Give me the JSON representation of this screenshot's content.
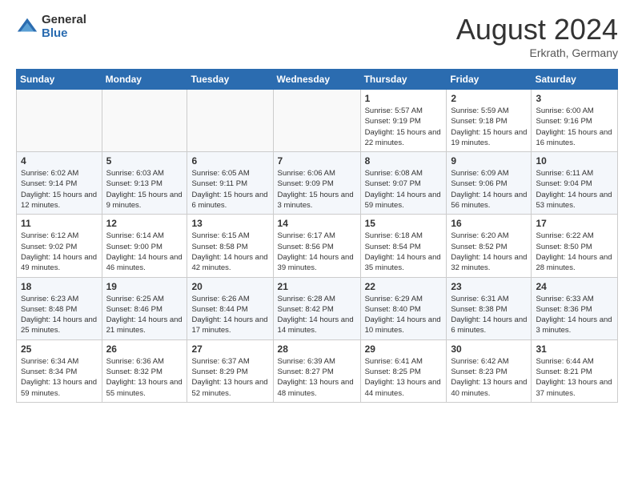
{
  "header": {
    "logo_general": "General",
    "logo_blue": "Blue",
    "month_title": "August 2024",
    "location": "Erkrath, Germany"
  },
  "days_of_week": [
    "Sunday",
    "Monday",
    "Tuesday",
    "Wednesday",
    "Thursday",
    "Friday",
    "Saturday"
  ],
  "weeks": [
    [
      {
        "day": "",
        "sunrise": "",
        "sunset": "",
        "daylight": ""
      },
      {
        "day": "",
        "sunrise": "",
        "sunset": "",
        "daylight": ""
      },
      {
        "day": "",
        "sunrise": "",
        "sunset": "",
        "daylight": ""
      },
      {
        "day": "",
        "sunrise": "",
        "sunset": "",
        "daylight": ""
      },
      {
        "day": "1",
        "sunrise": "5:57 AM",
        "sunset": "9:19 PM",
        "daylight": "15 hours and 22 minutes."
      },
      {
        "day": "2",
        "sunrise": "5:59 AM",
        "sunset": "9:18 PM",
        "daylight": "15 hours and 19 minutes."
      },
      {
        "day": "3",
        "sunrise": "6:00 AM",
        "sunset": "9:16 PM",
        "daylight": "15 hours and 16 minutes."
      }
    ],
    [
      {
        "day": "4",
        "sunrise": "6:02 AM",
        "sunset": "9:14 PM",
        "daylight": "15 hours and 12 minutes."
      },
      {
        "day": "5",
        "sunrise": "6:03 AM",
        "sunset": "9:13 PM",
        "daylight": "15 hours and 9 minutes."
      },
      {
        "day": "6",
        "sunrise": "6:05 AM",
        "sunset": "9:11 PM",
        "daylight": "15 hours and 6 minutes."
      },
      {
        "day": "7",
        "sunrise": "6:06 AM",
        "sunset": "9:09 PM",
        "daylight": "15 hours and 3 minutes."
      },
      {
        "day": "8",
        "sunrise": "6:08 AM",
        "sunset": "9:07 PM",
        "daylight": "14 hours and 59 minutes."
      },
      {
        "day": "9",
        "sunrise": "6:09 AM",
        "sunset": "9:06 PM",
        "daylight": "14 hours and 56 minutes."
      },
      {
        "day": "10",
        "sunrise": "6:11 AM",
        "sunset": "9:04 PM",
        "daylight": "14 hours and 53 minutes."
      }
    ],
    [
      {
        "day": "11",
        "sunrise": "6:12 AM",
        "sunset": "9:02 PM",
        "daylight": "14 hours and 49 minutes."
      },
      {
        "day": "12",
        "sunrise": "6:14 AM",
        "sunset": "9:00 PM",
        "daylight": "14 hours and 46 minutes."
      },
      {
        "day": "13",
        "sunrise": "6:15 AM",
        "sunset": "8:58 PM",
        "daylight": "14 hours and 42 minutes."
      },
      {
        "day": "14",
        "sunrise": "6:17 AM",
        "sunset": "8:56 PM",
        "daylight": "14 hours and 39 minutes."
      },
      {
        "day": "15",
        "sunrise": "6:18 AM",
        "sunset": "8:54 PM",
        "daylight": "14 hours and 35 minutes."
      },
      {
        "day": "16",
        "sunrise": "6:20 AM",
        "sunset": "8:52 PM",
        "daylight": "14 hours and 32 minutes."
      },
      {
        "day": "17",
        "sunrise": "6:22 AM",
        "sunset": "8:50 PM",
        "daylight": "14 hours and 28 minutes."
      }
    ],
    [
      {
        "day": "18",
        "sunrise": "6:23 AM",
        "sunset": "8:48 PM",
        "daylight": "14 hours and 25 minutes."
      },
      {
        "day": "19",
        "sunrise": "6:25 AM",
        "sunset": "8:46 PM",
        "daylight": "14 hours and 21 minutes."
      },
      {
        "day": "20",
        "sunrise": "6:26 AM",
        "sunset": "8:44 PM",
        "daylight": "14 hours and 17 minutes."
      },
      {
        "day": "21",
        "sunrise": "6:28 AM",
        "sunset": "8:42 PM",
        "daylight": "14 hours and 14 minutes."
      },
      {
        "day": "22",
        "sunrise": "6:29 AM",
        "sunset": "8:40 PM",
        "daylight": "14 hours and 10 minutes."
      },
      {
        "day": "23",
        "sunrise": "6:31 AM",
        "sunset": "8:38 PM",
        "daylight": "14 hours and 6 minutes."
      },
      {
        "day": "24",
        "sunrise": "6:33 AM",
        "sunset": "8:36 PM",
        "daylight": "14 hours and 3 minutes."
      }
    ],
    [
      {
        "day": "25",
        "sunrise": "6:34 AM",
        "sunset": "8:34 PM",
        "daylight": "13 hours and 59 minutes."
      },
      {
        "day": "26",
        "sunrise": "6:36 AM",
        "sunset": "8:32 PM",
        "daylight": "13 hours and 55 minutes."
      },
      {
        "day": "27",
        "sunrise": "6:37 AM",
        "sunset": "8:29 PM",
        "daylight": "13 hours and 52 minutes."
      },
      {
        "day": "28",
        "sunrise": "6:39 AM",
        "sunset": "8:27 PM",
        "daylight": "13 hours and 48 minutes."
      },
      {
        "day": "29",
        "sunrise": "6:41 AM",
        "sunset": "8:25 PM",
        "daylight": "13 hours and 44 minutes."
      },
      {
        "day": "30",
        "sunrise": "6:42 AM",
        "sunset": "8:23 PM",
        "daylight": "13 hours and 40 minutes."
      },
      {
        "day": "31",
        "sunrise": "6:44 AM",
        "sunset": "8:21 PM",
        "daylight": "13 hours and 37 minutes."
      }
    ]
  ]
}
